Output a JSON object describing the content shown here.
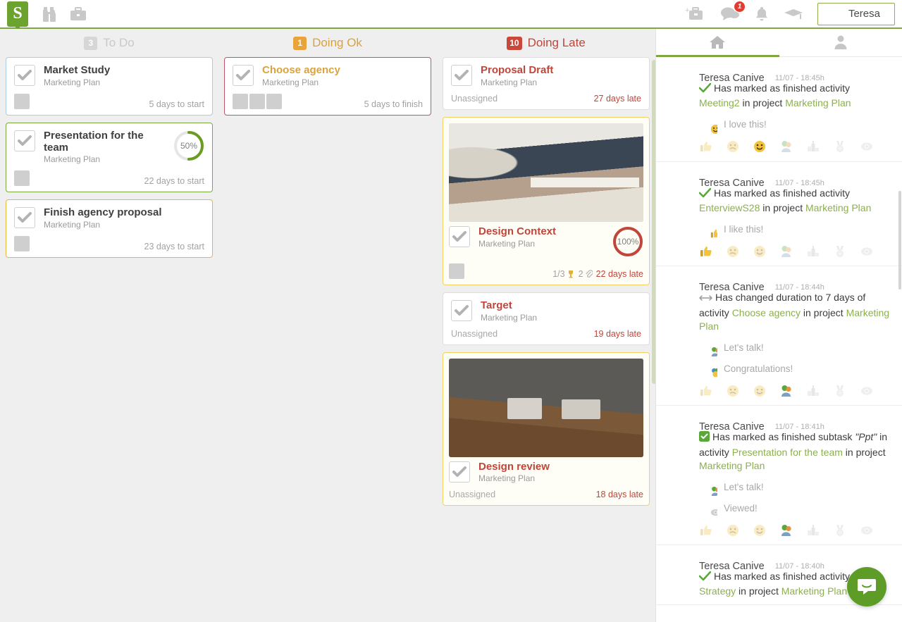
{
  "topbar": {
    "logo_text": "S",
    "icons": [
      {
        "name": "binoculars-icon"
      },
      {
        "name": "briefcase-icon"
      }
    ],
    "right_icons": [
      {
        "name": "add-project-icon"
      },
      {
        "name": "messages-icon",
        "badge": "1"
      },
      {
        "name": "notifications-bell-icon"
      },
      {
        "name": "graduation-cap-icon"
      }
    ],
    "user": {
      "name": "Teresa",
      "avatar": "teresa"
    }
  },
  "board": {
    "menu_icon": "hamburger-menu-icon",
    "columns": [
      {
        "id": "todo",
        "count": "3",
        "title": "To Do",
        "accent": "#c9c9c9",
        "badge_bg": "#d6d6d6",
        "cards": [
          {
            "title": "Market Study",
            "project": "Marketing Plan",
            "title_color": "dark",
            "border": "b-blue",
            "avatars": [
              "man"
            ],
            "due": "5 days to start",
            "due_style": "gray"
          },
          {
            "title": "Presentation for the team",
            "project": "Marketing Plan",
            "title_color": "dark",
            "border": "b-green",
            "avatars": [
              "man"
            ],
            "progress": 50,
            "progress_label": "50%",
            "progress_color": "#6b9c21",
            "due": "22 days to start",
            "due_style": "gray"
          },
          {
            "title": "Finish agency proposal",
            "project": "Marketing Plan",
            "title_color": "dark",
            "border": "b-amber",
            "avatars": [
              "teresa"
            ],
            "due": "23 days to start",
            "due_style": "gray"
          }
        ]
      },
      {
        "id": "doing-ok",
        "count": "1",
        "title": "Doing Ok",
        "accent": "#dda13a",
        "badge_bg": "#e8a33a",
        "cards": [
          {
            "title": "Choose agency",
            "project": "Marketing Plan",
            "title_color": "amber",
            "border": "b-pink",
            "avatars": [
              "red",
              "man",
              "teresa"
            ],
            "due": "5 days to finish",
            "due_style": "gray"
          }
        ]
      },
      {
        "id": "doing-late",
        "count": "10",
        "title": "Doing Late",
        "accent": "#c0453a",
        "badge_bg": "#c9483a",
        "cards": [
          {
            "title": "Proposal Draft",
            "project": "Marketing Plan",
            "title_color": "red",
            "border": "b-gray",
            "unassigned": "Unassigned",
            "due": "27 days late",
            "due_style": "red"
          },
          {
            "title": "Design Context",
            "project": "Marketing Plan",
            "title_color": "red",
            "border": "b-yellow",
            "image": "meeting-1",
            "avatars": [
              "teresa"
            ],
            "progress": 100,
            "progress_label": "100%",
            "progress_color": "#c0453a",
            "subtasks": "1/3",
            "attachments": "2",
            "due": "22 days late",
            "due_style": "red"
          },
          {
            "title": "Target",
            "project": "Marketing Plan",
            "title_color": "red",
            "border": "b-gray",
            "unassigned": "Unassigned",
            "due": "19 days late",
            "due_style": "red"
          },
          {
            "title": "Design review",
            "project": "Marketing Plan",
            "title_color": "red",
            "border": "b-yellow",
            "image": "meeting-2",
            "unassigned": "Unassigned",
            "due": "18 days late",
            "due_style": "red"
          }
        ]
      }
    ]
  },
  "feed": {
    "tabs": [
      {
        "name": "home-tab",
        "icon": "home-icon",
        "active": true
      },
      {
        "name": "profile-tab",
        "icon": "person-icon",
        "active": false
      }
    ],
    "items": [
      {
        "author": "Teresa Canive",
        "time": "11/07 - 18:45h",
        "avatar": "teresa",
        "icon": "check-icon",
        "text": [
          {
            "t": "Has marked as finished activity ",
            "k": "plain"
          },
          {
            "t": "Meeting2",
            "k": "link"
          },
          {
            "t": " in project ",
            "k": "plain"
          },
          {
            "t": "Marketing Plan",
            "k": "link"
          }
        ],
        "comments": [
          {
            "avatar": "teresa",
            "badge": "smile",
            "text": "I love this!"
          }
        ],
        "reactions": [
          "like",
          "meh",
          "smile",
          "talk",
          "podium",
          "medal",
          "eye"
        ],
        "active_reaction": "smile"
      },
      {
        "author": "Teresa Canive",
        "time": "11/07 - 18:45h",
        "avatar": "teresa",
        "icon": "check-icon",
        "text": [
          {
            "t": "Has marked as finished activity ",
            "k": "plain"
          },
          {
            "t": "EnterviewS28",
            "k": "link"
          },
          {
            "t": " in project ",
            "k": "plain"
          },
          {
            "t": "Marketing Plan",
            "k": "link"
          }
        ],
        "comments": [
          {
            "avatar": "teresa",
            "badge": "like",
            "text": "I like this!"
          }
        ],
        "reactions": [
          "like",
          "meh",
          "smile",
          "talk",
          "podium",
          "medal",
          "eye"
        ],
        "active_reaction": "like"
      },
      {
        "author": "Teresa Canive",
        "time": "11/07 - 18:44h",
        "avatar": "teresa",
        "icon": "duration-arrows-icon",
        "text": [
          {
            "t": "Has changed duration to 7 days of activity ",
            "k": "plain"
          },
          {
            "t": "Choose agency",
            "k": "link"
          },
          {
            "t": " in project ",
            "k": "plain"
          },
          {
            "t": "Marketing Plan",
            "k": "link"
          }
        ],
        "comments": [
          {
            "avatar": "teresa",
            "badge": "talk",
            "text": "Let's talk!"
          },
          {
            "avatar": "man",
            "badge": "congrats",
            "text": "Congratulations!"
          }
        ],
        "reactions": [
          "like",
          "meh",
          "smile",
          "talk",
          "podium",
          "medal",
          "eye"
        ],
        "active_reaction": "talk"
      },
      {
        "author": "Teresa Canive",
        "time": "11/07 - 18:41h",
        "avatar": "teresa",
        "icon": "checkbox-icon",
        "text": [
          {
            "t": "Has marked as finished subtask ",
            "k": "plain"
          },
          {
            "t": "\"Ppt\"",
            "k": "em"
          },
          {
            "t": " in activity ",
            "k": "plain"
          },
          {
            "t": "Presentation for the team",
            "k": "link"
          },
          {
            "t": " in project ",
            "k": "plain"
          },
          {
            "t": "Marketing Plan",
            "k": "link"
          }
        ],
        "comments": [
          {
            "avatar": "teresa",
            "badge": "talk",
            "text": "Let's talk!"
          },
          {
            "avatar": "man",
            "badge": "eye",
            "text": "Viewed!"
          }
        ],
        "reactions": [
          "like",
          "meh",
          "smile",
          "talk",
          "podium",
          "medal",
          "eye"
        ],
        "active_reaction": "talk"
      },
      {
        "author": "Teresa Canive",
        "time": "11/07 - 18:40h",
        "avatar": "teresa",
        "icon": "check-icon",
        "text": [
          {
            "t": "Has marked as finished activity ",
            "k": "plain"
          },
          {
            "t": "Social Strategy",
            "k": "link"
          },
          {
            "t": " in project ",
            "k": "plain"
          },
          {
            "t": "Marketing Plan",
            "k": "link"
          }
        ],
        "comments": [],
        "reactions": [],
        "active_reaction": ""
      }
    ],
    "chat_button": {
      "name": "chat-launcher-button",
      "icon": "chat-bubble-icon",
      "color": "#5e9c28"
    }
  }
}
